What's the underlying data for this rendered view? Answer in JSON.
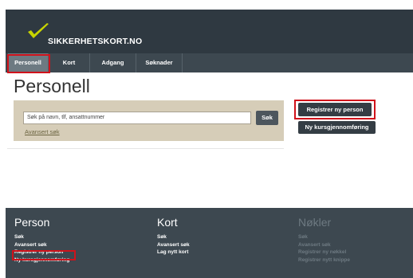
{
  "brand": {
    "name": "SIKKERHETSKORT.NO",
    "accent": "#c8d400",
    "header_bg": "#2f3941"
  },
  "nav": {
    "tabs": [
      {
        "label": "Personell"
      },
      {
        "label": "Kort"
      },
      {
        "label": "Adgang"
      },
      {
        "label": "Søknader"
      }
    ]
  },
  "page": {
    "title": "Personell",
    "search": {
      "placeholder": "Søk på navn, tlf, ansattnummer",
      "button": "Søk",
      "advanced": "Avansert søk"
    },
    "actions": {
      "register": "Registrer ny person",
      "course": "Ny kursgjennomføring"
    }
  },
  "footer": {
    "person": {
      "heading": "Person",
      "links": [
        "Søk",
        "Avansert søk",
        "Registrer ny person",
        "Ny kursgjennomføring"
      ]
    },
    "kort": {
      "heading": "Kort",
      "links": [
        "Søk",
        "Avansert søk",
        "Lag nytt kort"
      ]
    },
    "nokler": {
      "heading": "Nøkler",
      "links": [
        "Søk",
        "Avansert søk",
        "Registrer ny nøkkel",
        "Registrer nytt knippe"
      ]
    }
  },
  "highlight_color": "#d0121b"
}
